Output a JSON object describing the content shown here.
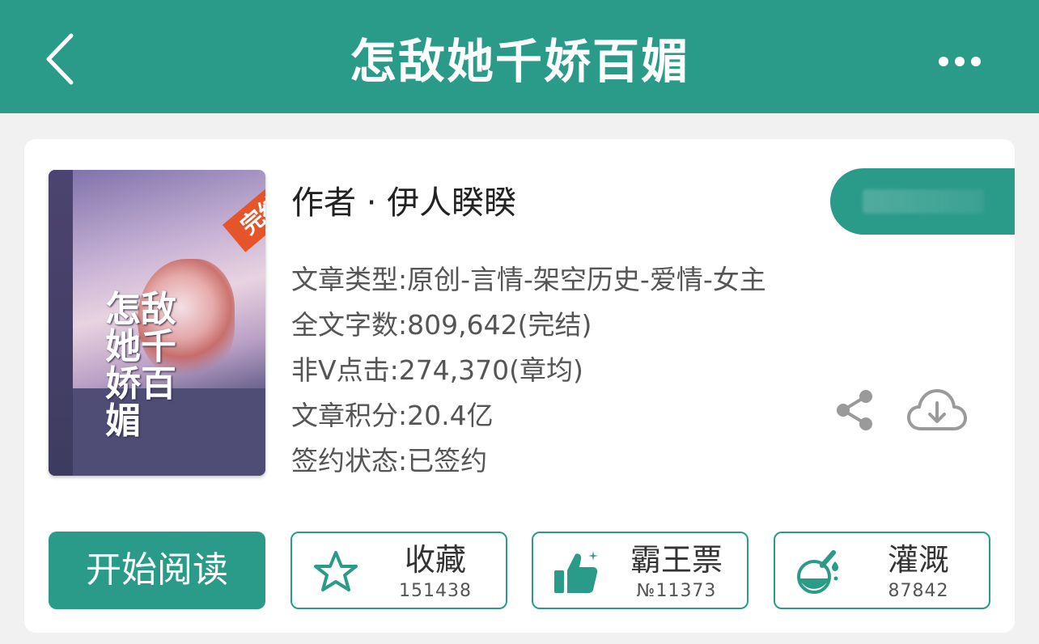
{
  "header": {
    "title": "怎敌她千娇百媚",
    "back_icon": "chevron-left-icon",
    "more_icon": "more-dots-icon"
  },
  "book": {
    "cover_title": "怎敌她千娇百媚",
    "badge": "完结",
    "author_line": "作者 · 伊人睽睽",
    "info": [
      "文章类型:原创-言情-架空历史-爱情-女主",
      "全文字数:809,642(完结)",
      "非Ⅴ点击:274,370(章均)",
      "文章积分:20.4亿",
      "签约状态:已签约"
    ]
  },
  "actions": {
    "read_label": "开始阅读",
    "favorite": {
      "label": "收藏",
      "value": "151438",
      "icon": "star-icon"
    },
    "vote": {
      "label": "霸王票",
      "value": "№11373",
      "icon": "thumbs-up-icon"
    },
    "water": {
      "label": "灌溉",
      "value": "87842",
      "icon": "flask-icon"
    }
  },
  "colors": {
    "accent": "#2a9a89",
    "badge": "#e6552a"
  }
}
